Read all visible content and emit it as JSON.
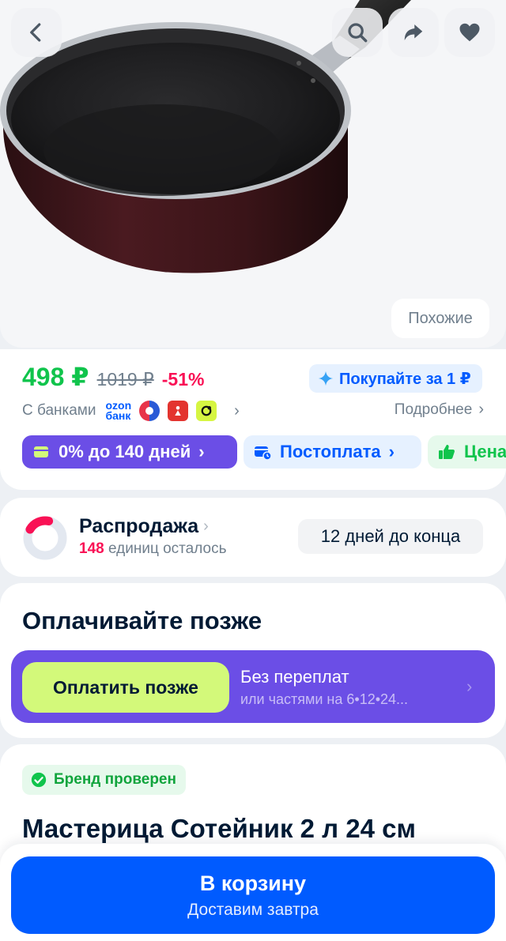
{
  "header": {
    "back_icon": "chevron-left-icon",
    "search_icon": "search-icon",
    "share_icon": "share-icon",
    "favorite_icon": "heart-icon"
  },
  "gallery": {
    "similar_label": "Похожие"
  },
  "price": {
    "current": "498 ₽",
    "old": "1019 ₽",
    "discount": "-51%",
    "promo_label": "Покупайте за 1 ₽",
    "banks_label": "С банками",
    "ozon_bank_top": "ozon",
    "ozon_bank_bottom": "банк",
    "more_label": "Подробнее",
    "chips": [
      {
        "label": "0% до 140 дней",
        "icon": "card-icon"
      },
      {
        "label": "Постоплата",
        "icon": "wallet-clock-icon"
      },
      {
        "label": "Цена",
        "icon": "thumbs-up-icon"
      }
    ],
    "colors": {
      "price": "#10c44c",
      "discount": "#f91155",
      "accent": "#005bff"
    }
  },
  "sale": {
    "title": "Распродажа",
    "count": "148",
    "remaining_label": "единиц осталось",
    "days_left": "12 дней до конца",
    "remaining_fraction": 0.2
  },
  "pay_later": {
    "title": "Оплачивайте позже",
    "button_label": "Оплатить позже",
    "line1": "Без переплат",
    "line2": "или частями на 6•12•24..."
  },
  "product": {
    "brand_badge": "Бренд проверен",
    "title": "Мастерица Сотейник 2 л 24 см"
  },
  "cart": {
    "button_label": "В корзину",
    "delivery_label": "Доставим завтра"
  }
}
